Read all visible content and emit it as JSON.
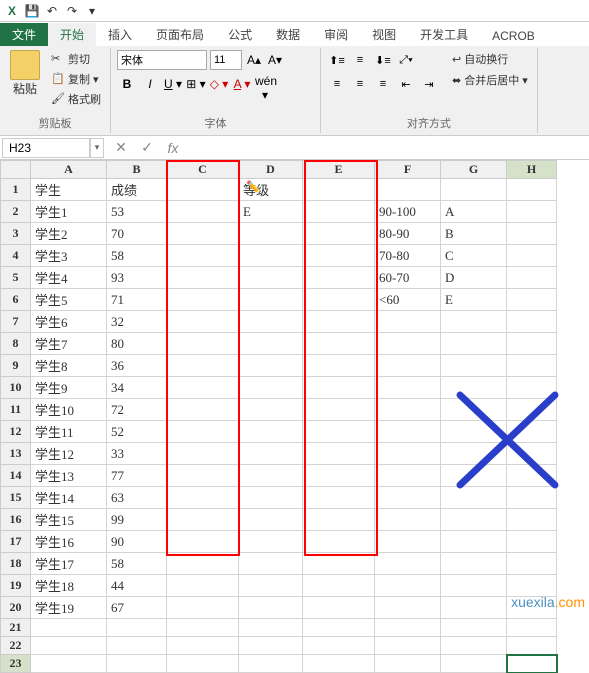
{
  "quickAccess": {
    "save": "💾",
    "undo": "↶",
    "redo": "↷"
  },
  "tabs": [
    "文件",
    "开始",
    "插入",
    "页面布局",
    "公式",
    "数据",
    "审阅",
    "视图",
    "开发工具",
    "ACROB"
  ],
  "activeTab": 1,
  "ribbon": {
    "clipboard": {
      "paste": "粘贴",
      "cut": "剪切",
      "copy": "复制",
      "format": "格式刷",
      "label": "剪贴板"
    },
    "font": {
      "family": "宋体",
      "size": "11",
      "label": "字体"
    },
    "align": {
      "wrap": "自动换行",
      "merge": "合并后居中",
      "label": "对齐方式"
    }
  },
  "nameBox": "H23",
  "formulaBar": "",
  "columns": [
    "A",
    "B",
    "C",
    "D",
    "E",
    "F",
    "G",
    "H"
  ],
  "rows": [
    1,
    2,
    3,
    4,
    5,
    6,
    7,
    8,
    9,
    10,
    11,
    12,
    13,
    14,
    15,
    16,
    17,
    18,
    19,
    20,
    21,
    22,
    23
  ],
  "activeCol": 7,
  "activeRow": 22,
  "cells": {
    "A1": "学生",
    "B1": "成绩",
    "D1": "等级",
    "A2": "学生1",
    "B2": "53",
    "D2": "E",
    "F2": "90-100",
    "G2": "A",
    "A3": "学生2",
    "B3": "70",
    "F3": "80-90",
    "G3": "B",
    "A4": "学生3",
    "B4": "58",
    "F4": "70-80",
    "G4": "C",
    "A5": "学生4",
    "B5": "93",
    "F5": "60-70",
    "G5": "D",
    "A6": "学生5",
    "B6": "71",
    "F6": "<60",
    "G6": "E",
    "A7": "学生6",
    "B7": "32",
    "A8": "学生7",
    "B8": "80",
    "A9": "学生8",
    "B9": "36",
    "A10": "学生9",
    "B10": "34",
    "A11": "学生10",
    "B11": "72",
    "A12": "学生11",
    "B12": "52",
    "A13": "学生12",
    "B13": "33",
    "A14": "学生13",
    "B14": "77",
    "A15": "学生14",
    "B15": "63",
    "A16": "学生15",
    "B16": "99",
    "A17": "学生16",
    "B17": "90",
    "A18": "学生17",
    "B18": "58",
    "A19": "学生18",
    "B19": "44",
    "A20": "学生19",
    "B20": "67"
  },
  "watermark": {
    "a": "xuexila",
    "b": ".com"
  }
}
